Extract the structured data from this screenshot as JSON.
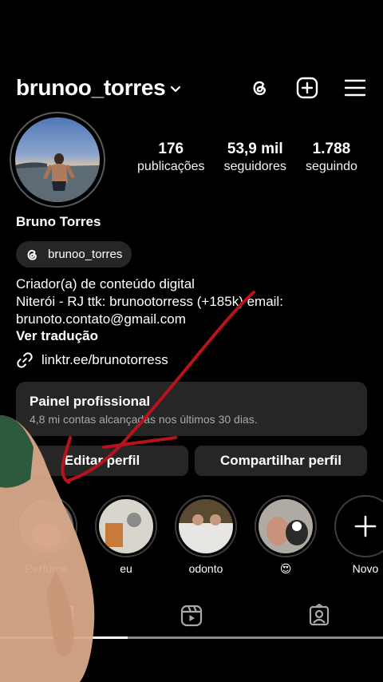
{
  "header": {
    "username": "brunoo_torres",
    "icons": [
      "chevron-down-icon",
      "threads-icon",
      "add-post-icon",
      "menu-icon"
    ]
  },
  "profile": {
    "display_name": "Bruno Torres",
    "threads_handle": "brunoo_torres",
    "bio_lines": [
      "Criador(a) de conteúdo digital",
      "Niterói - RJ ttk: brunootorress (+185k) email:",
      "brunoto.contato@gmail.com"
    ],
    "translate_label": "Ver tradução",
    "link": "linktr.ee/brunotorress"
  },
  "stats": [
    {
      "value": "176",
      "label": "publicações"
    },
    {
      "value": "53,9 mil",
      "label": "seguidores"
    },
    {
      "value": "1.788",
      "label": "seguindo"
    }
  ],
  "panel": {
    "title": "Painel profissional",
    "subtitle": "4,8 mi contas alcançadas nos últimos 30 dias."
  },
  "buttons": {
    "edit": "Editar perfil",
    "share": "Compartilhar perfil"
  },
  "highlights": [
    {
      "label": "Perfume"
    },
    {
      "label": "eu"
    },
    {
      "label": "odonto"
    },
    {
      "label": "😍"
    },
    {
      "label": "Novo"
    }
  ],
  "tabs": [
    "grid-icon",
    "reels-icon",
    "tagged-icon"
  ],
  "colors": {
    "background": "#000000",
    "surface": "#262626",
    "muted_text": "#a8a8a8",
    "annotation_red": "#b8121b"
  }
}
